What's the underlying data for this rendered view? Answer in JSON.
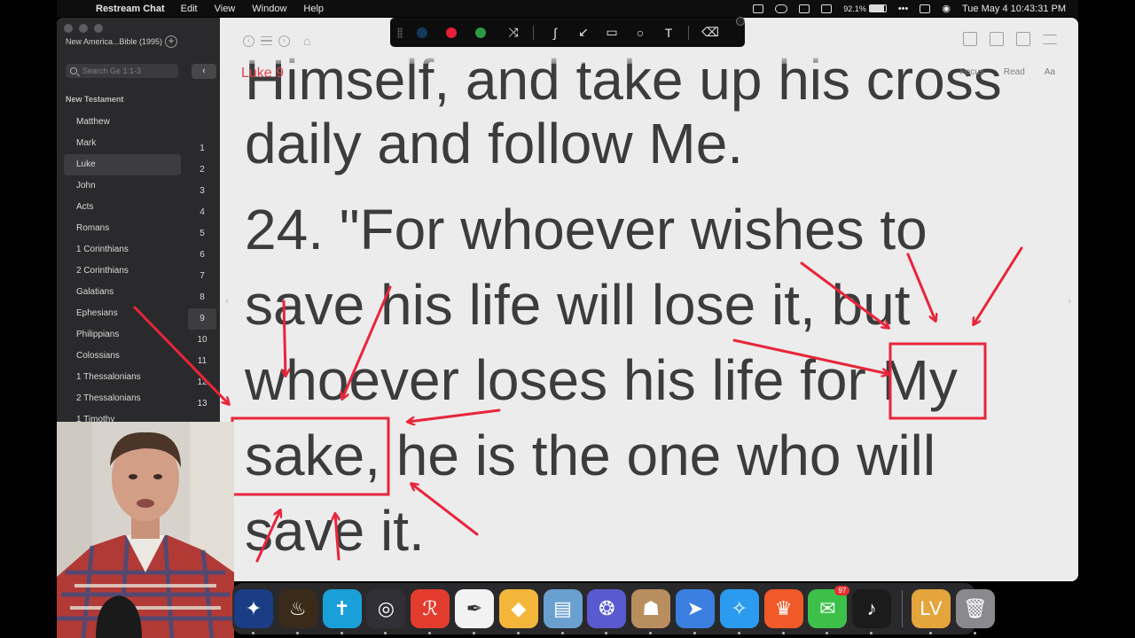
{
  "menubar": {
    "app_name": "Restream Chat",
    "menus": [
      "Edit",
      "View",
      "Window",
      "Help"
    ],
    "battery": "92.1%",
    "datetime": "Tue May 4  10:43:31 PM"
  },
  "sidebar": {
    "bible_version": "New America...Bible (1995)",
    "search_placeholder": "Search Ge 1:1-3",
    "section_title": "New Testament",
    "books": [
      "Matthew",
      "Mark",
      "Luke",
      "John",
      "Acts",
      "Romans",
      "1 Corinthians",
      "2 Corinthians",
      "Galatians",
      "Ephesians",
      "Philippians",
      "Colossians",
      "1 Thessalonians",
      "2 Thessalonians",
      "1 Timothy"
    ],
    "active_book": "Luke",
    "chapters": [
      "1",
      "2",
      "3",
      "4",
      "5",
      "6",
      "7",
      "8",
      "9",
      "10",
      "11",
      "12",
      "13"
    ],
    "active_chapter": "9"
  },
  "reader": {
    "chapter_title": "Luke 9",
    "view_tabs": [
      "Focus",
      "Read",
      "Aa"
    ],
    "lines": [
      "Himself, and take up his cross",
      "daily and follow Me.",
      "24. \"For whoever wishes to",
      "save his life will lose it, but",
      "whoever loses his life for My",
      "sake, he is the one who will",
      "save it."
    ]
  },
  "annotation_toolbar": {
    "colors": [
      "#123a5c",
      "#e51f3a",
      "#2a9a45"
    ],
    "tools": [
      "shuffle-icon",
      "pen-icon",
      "arrow-icon",
      "rectangle-icon",
      "ellipse-icon",
      "text-icon",
      "eraser-icon"
    ],
    "text_tool_label": "T"
  },
  "annotation_color": "#e8253b",
  "dock": {
    "apps": [
      {
        "name": "bible-app"
      },
      {
        "name": "lamp-app"
      },
      {
        "name": "cross-bible-app"
      },
      {
        "name": "obs-app"
      },
      {
        "name": "readdle-app"
      },
      {
        "name": "pen-app"
      },
      {
        "name": "shapes-app"
      },
      {
        "name": "preview-app"
      },
      {
        "name": "spark-app"
      },
      {
        "name": "contacts-app"
      },
      {
        "name": "navigator-app"
      },
      {
        "name": "safari-app"
      },
      {
        "name": "brave-app"
      },
      {
        "name": "messages-app",
        "badge": "97"
      },
      {
        "name": "piano-app"
      }
    ],
    "after_separator": [
      {
        "name": "lv-app"
      },
      {
        "name": "trash"
      }
    ]
  }
}
